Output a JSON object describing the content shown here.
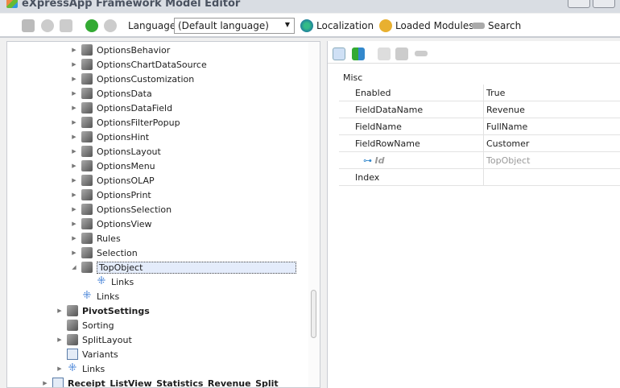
{
  "window": {
    "title": "eXpressApp Framework Model Editor"
  },
  "toolbar": {
    "language_label": "Language",
    "language_value": "(Default language)",
    "localization": "Localization",
    "loaded_modules": "Loaded Modules",
    "search": "Search"
  },
  "tree": [
    {
      "label": "OptionsBehavior",
      "indent": 1,
      "arrow": "collapsed",
      "icon": "cube"
    },
    {
      "label": "OptionsChartDataSource",
      "indent": 1,
      "arrow": "collapsed",
      "icon": "cube"
    },
    {
      "label": "OptionsCustomization",
      "indent": 1,
      "arrow": "collapsed",
      "icon": "cube"
    },
    {
      "label": "OptionsData",
      "indent": 1,
      "arrow": "collapsed",
      "icon": "cube"
    },
    {
      "label": "OptionsDataField",
      "indent": 1,
      "arrow": "collapsed",
      "icon": "cube"
    },
    {
      "label": "OptionsFilterPopup",
      "indent": 1,
      "arrow": "collapsed",
      "icon": "cube"
    },
    {
      "label": "OptionsHint",
      "indent": 1,
      "arrow": "collapsed",
      "icon": "cube"
    },
    {
      "label": "OptionsLayout",
      "indent": 1,
      "arrow": "collapsed",
      "icon": "cube"
    },
    {
      "label": "OptionsMenu",
      "indent": 1,
      "arrow": "collapsed",
      "icon": "cube"
    },
    {
      "label": "OptionsOLAP",
      "indent": 1,
      "arrow": "collapsed",
      "icon": "cube"
    },
    {
      "label": "OptionsPrint",
      "indent": 1,
      "arrow": "collapsed",
      "icon": "cube"
    },
    {
      "label": "OptionsSelection",
      "indent": 1,
      "arrow": "collapsed",
      "icon": "cube"
    },
    {
      "label": "OptionsView",
      "indent": 1,
      "arrow": "collapsed",
      "icon": "cube"
    },
    {
      "label": "Rules",
      "indent": 1,
      "arrow": "collapsed",
      "icon": "cube"
    },
    {
      "label": "Selection",
      "indent": 1,
      "arrow": "collapsed",
      "icon": "cube"
    },
    {
      "label": "TopObject",
      "indent": 1,
      "arrow": "expanded",
      "icon": "cube",
      "selected": true
    },
    {
      "label": "Links",
      "indent": 2,
      "arrow": "none",
      "icon": "links"
    },
    {
      "label": "Links",
      "indent": 1,
      "arrow": "none",
      "icon": "links"
    },
    {
      "label": "PivotSettings",
      "indent": 0,
      "arrow": "collapsed",
      "icon": "cube",
      "bold": true
    },
    {
      "label": "Sorting",
      "indent": 0,
      "arrow": "none",
      "icon": "cube"
    },
    {
      "label": "SplitLayout",
      "indent": 0,
      "arrow": "collapsed",
      "icon": "cube"
    },
    {
      "label": "Variants",
      "indent": 0,
      "arrow": "none",
      "icon": "listview"
    },
    {
      "label": "Links",
      "indent": 0,
      "arrow": "collapsed",
      "icon": "links"
    },
    {
      "label": "Receipt_ListView_Statistics_Revenue_Split",
      "indent": -1,
      "arrow": "collapsed",
      "icon": "listview",
      "bold": true
    }
  ],
  "properties": {
    "category": "Misc",
    "rows": [
      {
        "name": "Enabled",
        "value": "True"
      },
      {
        "name": "FieldDataName",
        "value": "Revenue"
      },
      {
        "name": "FieldName",
        "value": "FullName"
      },
      {
        "name": "FieldRowName",
        "value": "Customer"
      },
      {
        "name": "Id",
        "value": "TopObject",
        "readonly": true,
        "key": true
      },
      {
        "name": "Index",
        "value": ""
      }
    ]
  }
}
